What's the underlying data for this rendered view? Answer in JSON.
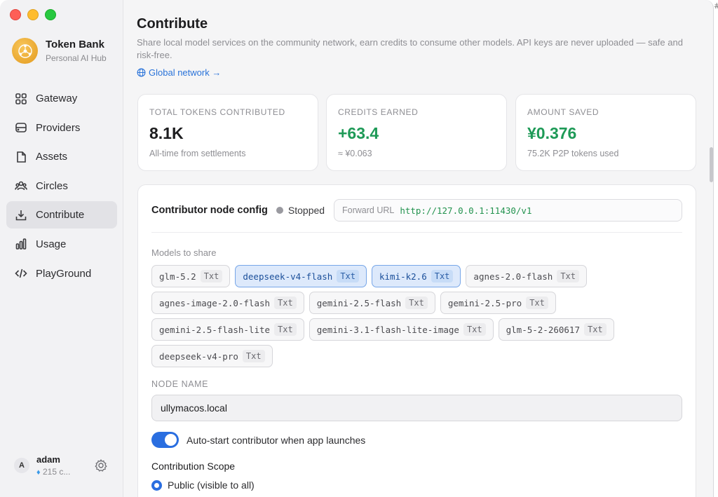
{
  "app": {
    "name": "Token Bank",
    "subtitle": "Personal AI Hub"
  },
  "sidebar": {
    "items": [
      {
        "label": "Gateway",
        "icon": "grid-icon"
      },
      {
        "label": "Providers",
        "icon": "server-icon"
      },
      {
        "label": "Assets",
        "icon": "document-icon"
      },
      {
        "label": "Circles",
        "icon": "users-icon"
      },
      {
        "label": "Contribute",
        "icon": "download-icon",
        "active": true
      },
      {
        "label": "Usage",
        "icon": "bar-chart-icon"
      },
      {
        "label": "PlayGround",
        "icon": "code-icon"
      }
    ]
  },
  "user": {
    "initial": "A",
    "name": "adam",
    "credits": "215 c..."
  },
  "page": {
    "title": "Contribute",
    "description": "Share local model services on the community network, earn credits to consume other models. API keys are never uploaded — safe and risk-free.",
    "global_link": "Global network →"
  },
  "stats": [
    {
      "label": "TOTAL TOKENS CONTRIBUTED",
      "value": "8.1K",
      "sub": "All-time from settlements",
      "color": "#1d1d1f"
    },
    {
      "label": "CREDITS EARNED",
      "value": "+63.4",
      "sub": "≈ ¥0.063",
      "color": "#1e9a57"
    },
    {
      "label": "AMOUNT SAVED",
      "value": "¥0.376",
      "sub": "75.2K P2P tokens used",
      "color": "#1e9a57"
    }
  ],
  "config": {
    "title": "Contributor node config",
    "status": "Stopped",
    "forward_label": "Forward URL",
    "forward_url": "http://127.0.0.1:11430/v1",
    "models_label": "Models to share",
    "models": [
      {
        "name": "glm-5.2",
        "tag": "Txt",
        "selected": false
      },
      {
        "name": "deepseek-v4-flash",
        "tag": "Txt",
        "selected": true
      },
      {
        "name": "kimi-k2.6",
        "tag": "Txt",
        "selected": true
      },
      {
        "name": "agnes-2.0-flash",
        "tag": "Txt",
        "selected": false
      },
      {
        "name": "agnes-image-2.0-flash",
        "tag": "Txt",
        "selected": false
      },
      {
        "name": "gemini-2.5-flash",
        "tag": "Txt",
        "selected": false
      },
      {
        "name": "gemini-2.5-pro",
        "tag": "Txt",
        "selected": false
      },
      {
        "name": "gemini-2.5-flash-lite",
        "tag": "Txt",
        "selected": false
      },
      {
        "name": "gemini-3.1-flash-lite-image",
        "tag": "Txt",
        "selected": false
      },
      {
        "name": "glm-5-2-260617",
        "tag": "Txt",
        "selected": false
      },
      {
        "name": "deepseek-v4-pro",
        "tag": "Txt",
        "selected": false
      }
    ],
    "node_name_label": "NODE NAME",
    "node_name": "ullymacos.local",
    "auto_start_label": "Auto-start contributor when app launches",
    "auto_start": true,
    "scope_title": "Contribution Scope",
    "scope_option": "Public (visible to all)"
  },
  "edge_text": "#",
  "colors": {
    "accent": "#2a6ee0",
    "positive": "#1e9a57",
    "url": "#23934f"
  }
}
